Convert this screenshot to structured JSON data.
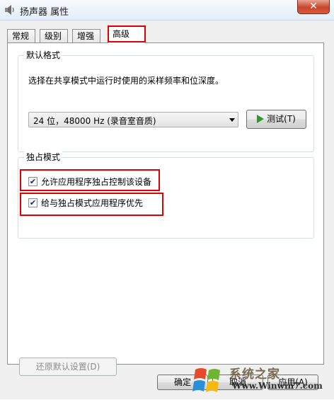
{
  "window": {
    "title": "扬声器 属性",
    "close_glyph": "✕"
  },
  "tabs": [
    {
      "label": "常规",
      "active": false
    },
    {
      "label": "级别",
      "active": false
    },
    {
      "label": "增强",
      "active": false
    },
    {
      "label": "高级",
      "active": true
    }
  ],
  "default_format": {
    "group_title": "默认格式",
    "description": "选择在共享模式中运行时使用的采样频率和位深度。",
    "selected_format": "24 位，48000 Hz (录音室音质)",
    "test_button": "测试(T)"
  },
  "exclusive_mode": {
    "group_title": "独占模式",
    "options": [
      {
        "label": "允许应用程序独占控制该设备",
        "checked": true
      },
      {
        "label": "给与独占模式应用程序优先",
        "checked": true
      }
    ]
  },
  "buttons": {
    "restore_defaults": "还原默认设置(D)",
    "ok": "确定",
    "cancel": "取消",
    "apply": "应用(A)"
  },
  "watermark": {
    "logo_text": "系统之家",
    "url": "Www.Winwin7.com"
  },
  "colors": {
    "highlight_red": "#e00000",
    "play_green": "#2e9a2e",
    "close_red": "#c8452d"
  },
  "icons": {
    "window": "speaker-icon",
    "test": "play-icon",
    "close": "close-icon"
  }
}
